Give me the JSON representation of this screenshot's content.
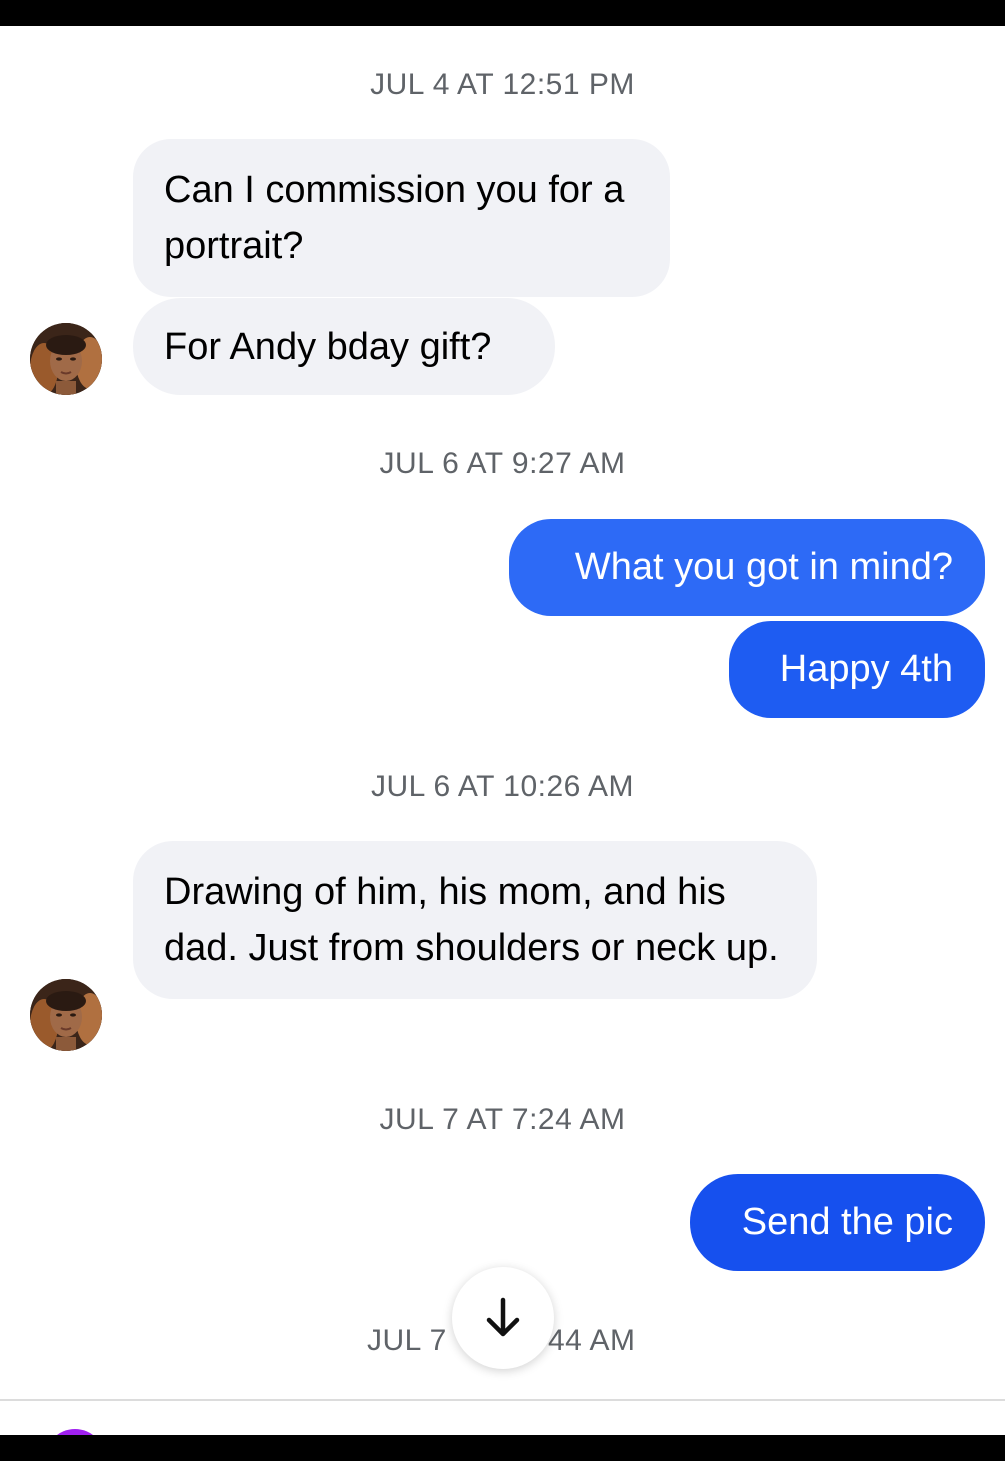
{
  "colors": {
    "incoming_bubble": "#f1f2f6",
    "outgoing_bubble_1": "#2d6af6",
    "outgoing_bubble_2": "#1e5cf2",
    "outgoing_bubble_3": "#1650ee",
    "timestamp_text": "#5f6368",
    "compose_avatar": "#a020f0"
  },
  "conversation": {
    "timestamps": [
      "JUL 4 AT 12:51 PM",
      "JUL 6 AT 9:27 AM",
      "JUL 6 AT 10:26 AM",
      "JUL 7 AT 7:24 AM",
      "JUL 7",
      "44 AM"
    ],
    "messages": [
      {
        "direction": "incoming",
        "text": "Can I commission you for a portrait?"
      },
      {
        "direction": "incoming",
        "text": "For Andy bday gift?"
      },
      {
        "direction": "outgoing",
        "text": "What you got in mind?"
      },
      {
        "direction": "outgoing",
        "text": "Happy 4th"
      },
      {
        "direction": "incoming",
        "text": "Drawing of him, his mom, and his dad. Just from shoulders or neck up."
      },
      {
        "direction": "outgoing",
        "text": "Send the pic"
      }
    ]
  },
  "scroll_button": {
    "icon": "arrow-down-icon"
  },
  "avatars": {
    "contact_icon": "contact-avatar",
    "composer_icon": "user-avatar"
  }
}
